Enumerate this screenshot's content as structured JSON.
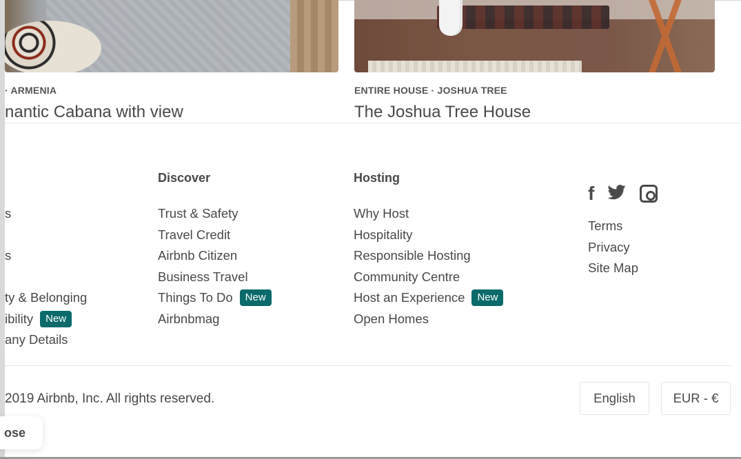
{
  "listings": [
    {
      "subtitle": "· ARMENIA",
      "title": "nantic Cabana with view"
    },
    {
      "subtitle": "ENTIRE HOUSE · JOSHUA TREE",
      "title": "The Joshua Tree House"
    }
  ],
  "footer": {
    "columns": [
      {
        "heading": "",
        "items": [
          {
            "label": "s"
          },
          {
            "label": ""
          },
          {
            "label": "s"
          },
          {
            "label": ""
          },
          {
            "label": "ty & Belonging"
          },
          {
            "label": "ibility",
            "badge": "New"
          },
          {
            "label": "any Details"
          }
        ]
      },
      {
        "heading": "Discover",
        "items": [
          {
            "label": "Trust & Safety"
          },
          {
            "label": "Travel Credit"
          },
          {
            "label": "Airbnb Citizen"
          },
          {
            "label": "Business Travel"
          },
          {
            "label": "Things To Do",
            "badge": "New"
          },
          {
            "label": "Airbnbmag"
          }
        ]
      },
      {
        "heading": "Hosting",
        "items": [
          {
            "label": "Why Host"
          },
          {
            "label": "Hospitality"
          },
          {
            "label": "Responsible Hosting"
          },
          {
            "label": "Community Centre"
          },
          {
            "label": "Host an Experience",
            "badge": "New"
          },
          {
            "label": "Open Homes"
          }
        ]
      }
    ],
    "social": [
      "facebook-icon",
      "twitter-icon",
      "instagram-icon"
    ],
    "legal": [
      "Terms",
      "Privacy",
      "Site Map"
    ],
    "copyright": "2019 Airbnb, Inc. All rights reserved.",
    "language_button": "English",
    "currency_button": "EUR - €",
    "close_pill": "ose"
  },
  "colors": {
    "badge": "#0b6a6a",
    "text": "#484848"
  }
}
